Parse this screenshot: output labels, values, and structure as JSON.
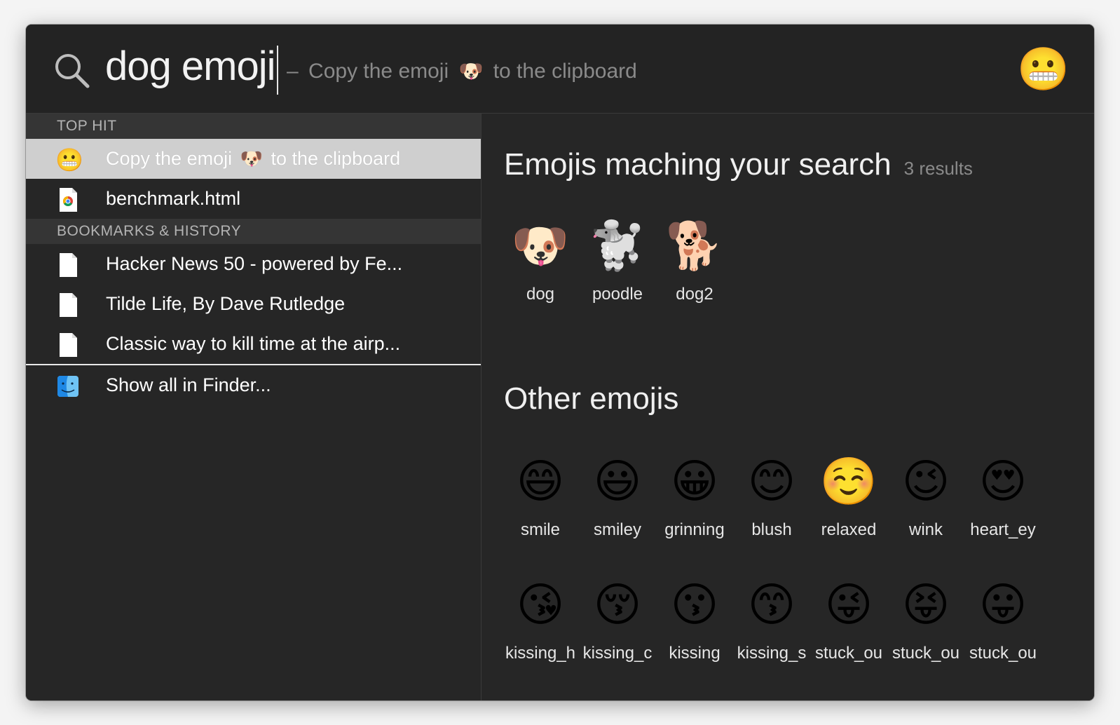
{
  "search": {
    "query": "dog emoji",
    "hint_dash": "–",
    "hint_prefix": "Copy the emoji",
    "hint_emoji": "🐶",
    "hint_suffix": "to the clipboard",
    "preview_emoji": "😬"
  },
  "sections": {
    "top_hit": "TOP HIT",
    "bookmarks": "BOOKMARKS & HISTORY"
  },
  "results": {
    "top_hit": {
      "prefix": "Copy the emoji",
      "emoji": "🐶",
      "suffix": "to the clipboard",
      "icon": "😬"
    },
    "benchmark": "benchmark.html",
    "bookmarks": [
      "Hacker News 50 - powered by Fe...",
      "Tilde Life, By Dave Rutledge",
      "Classic way to kill time at the airp..."
    ],
    "show_all": "Show all in Finder..."
  },
  "matching": {
    "title": "Emojis maching your search",
    "count": "3 results",
    "items": [
      {
        "emoji": "🐶",
        "name": "dog"
      },
      {
        "emoji": "🐩",
        "name": "poodle"
      },
      {
        "emoji": "🐕",
        "name": "dog2"
      }
    ]
  },
  "other": {
    "title": "Other emojis",
    "items": [
      {
        "emoji": "😄",
        "name": "smile"
      },
      {
        "emoji": "😃",
        "name": "smiley"
      },
      {
        "emoji": "😀",
        "name": "grinning"
      },
      {
        "emoji": "😊",
        "name": "blush"
      },
      {
        "emoji": "☺️",
        "name": "relaxed"
      },
      {
        "emoji": "😉",
        "name": "wink"
      },
      {
        "emoji": "😍",
        "name": "heart_ey"
      },
      {
        "emoji": "😘",
        "name": "kissing_h"
      },
      {
        "emoji": "😚",
        "name": "kissing_c"
      },
      {
        "emoji": "😗",
        "name": "kissing"
      },
      {
        "emoji": "😙",
        "name": "kissing_s"
      },
      {
        "emoji": "😜",
        "name": "stuck_ou"
      },
      {
        "emoji": "😝",
        "name": "stuck_ou"
      },
      {
        "emoji": "😛",
        "name": "stuck_ou"
      }
    ]
  },
  "colors": {
    "window_bg": "#262626",
    "section_bg": "#353535",
    "selected_bg": "#cfcfcf"
  }
}
